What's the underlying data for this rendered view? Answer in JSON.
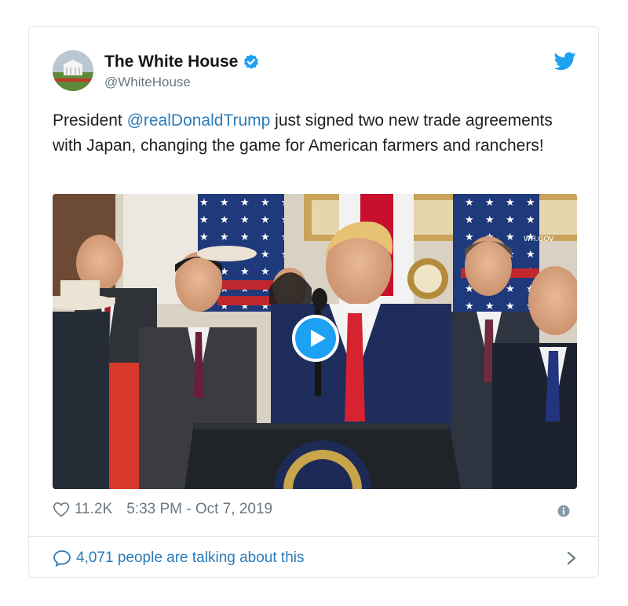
{
  "account": {
    "display_name": "The White House",
    "handle": "@WhiteHouse",
    "verified": true
  },
  "tweet": {
    "text_before": "President ",
    "mention": "@realDonaldTrump",
    "text_after": " just signed two new trade agreements with Japan, changing the game for American farmers and ranchers!"
  },
  "media": {
    "type": "video",
    "watermark": "WH.GOV",
    "seal_text": "SEAL OF THE PRESIDENT OF THE UNITED STATES"
  },
  "meta": {
    "likes": "11.2K",
    "timestamp": "5:33 PM - Oct 7, 2019"
  },
  "footer": {
    "talking": "4,071 people are talking about this"
  },
  "colors": {
    "link": "#2b7bb9",
    "twitter_blue": "#1da1f2",
    "muted": "#697882",
    "border": "#e1e8ed"
  },
  "icons": [
    "verified-badge-icon",
    "twitter-bird-icon",
    "play-icon",
    "heart-icon",
    "info-icon",
    "speech-bubble-icon",
    "chevron-right-icon"
  ]
}
